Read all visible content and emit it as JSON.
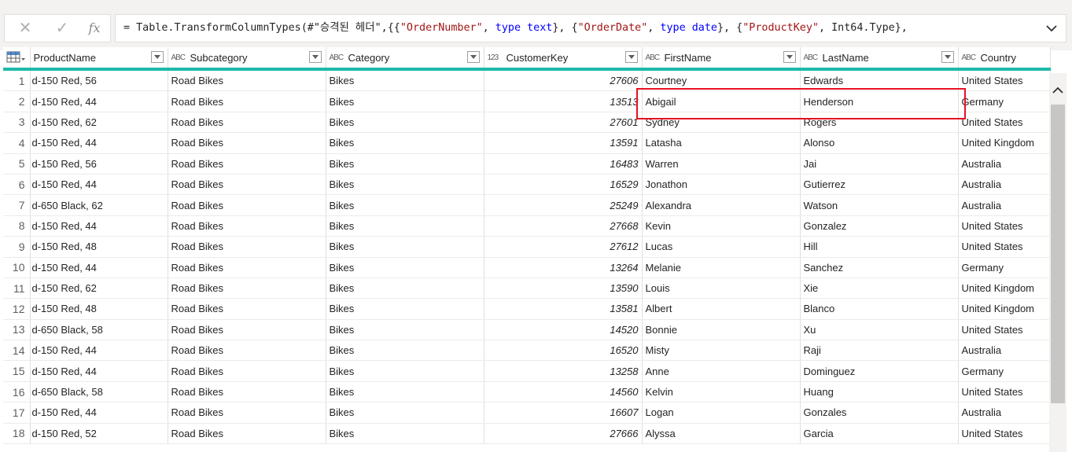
{
  "formula_bar": {
    "cancel_glyph": "✕",
    "commit_glyph": "✓",
    "fx_glyph": "fx",
    "formula_parts": [
      {
        "t": "= Table.TransformColumnTypes(#\"승격된 헤더\",{{",
        "c": "plain"
      },
      {
        "t": "\"OrderNumber\"",
        "c": "str"
      },
      {
        "t": ", ",
        "c": "plain"
      },
      {
        "t": "type",
        "c": "kw"
      },
      {
        "t": " ",
        "c": "plain"
      },
      {
        "t": "text",
        "c": "kw"
      },
      {
        "t": "}, {",
        "c": "plain"
      },
      {
        "t": "\"OrderDate\"",
        "c": "str"
      },
      {
        "t": ", ",
        "c": "plain"
      },
      {
        "t": "type",
        "c": "kw"
      },
      {
        "t": " ",
        "c": "plain"
      },
      {
        "t": "date",
        "c": "kw"
      },
      {
        "t": "}, {",
        "c": "plain"
      },
      {
        "t": "\"ProductKey\"",
        "c": "str"
      },
      {
        "t": ", Int64.Type},",
        "c": "plain"
      }
    ]
  },
  "columns": [
    {
      "name": "ProductName",
      "type_icon": "",
      "dropdown": true
    },
    {
      "name": "Subcategory",
      "type_icon": "ABC",
      "dropdown": true
    },
    {
      "name": "Category",
      "type_icon": "ABC",
      "dropdown": true
    },
    {
      "name": "CustomerKey",
      "type_icon": "123",
      "dropdown": true
    },
    {
      "name": "FirstName",
      "type_icon": "ABC",
      "dropdown": true
    },
    {
      "name": "LastName",
      "type_icon": "ABC",
      "dropdown": true
    },
    {
      "name": "Country",
      "type_icon": "ABC",
      "dropdown": false
    }
  ],
  "rows": [
    [
      "1",
      "d-150 Red, 56",
      "Road Bikes",
      "Bikes",
      "27606",
      "Courtney",
      "Edwards",
      "United States"
    ],
    [
      "2",
      "d-150 Red, 44",
      "Road Bikes",
      "Bikes",
      "13513",
      "Abigail",
      "Henderson",
      "Germany"
    ],
    [
      "3",
      "d-150 Red, 62",
      "Road Bikes",
      "Bikes",
      "27601",
      "Sydney",
      "Rogers",
      "United States"
    ],
    [
      "4",
      "d-150 Red, 44",
      "Road Bikes",
      "Bikes",
      "13591",
      "Latasha",
      "Alonso",
      "United Kingdom"
    ],
    [
      "5",
      "d-150 Red, 56",
      "Road Bikes",
      "Bikes",
      "16483",
      "Warren",
      "Jai",
      "Australia"
    ],
    [
      "6",
      "d-150 Red, 44",
      "Road Bikes",
      "Bikes",
      "16529",
      "Jonathon",
      "Gutierrez",
      "Australia"
    ],
    [
      "7",
      "d-650 Black, 62",
      "Road Bikes",
      "Bikes",
      "25249",
      "Alexandra",
      "Watson",
      "Australia"
    ],
    [
      "8",
      "d-150 Red, 44",
      "Road Bikes",
      "Bikes",
      "27668",
      "Kevin",
      "Gonzalez",
      "United States"
    ],
    [
      "9",
      "d-150 Red, 48",
      "Road Bikes",
      "Bikes",
      "27612",
      "Lucas",
      "Hill",
      "United States"
    ],
    [
      "10",
      "d-150 Red, 44",
      "Road Bikes",
      "Bikes",
      "13264",
      "Melanie",
      "Sanchez",
      "Germany"
    ],
    [
      "11",
      "d-150 Red, 62",
      "Road Bikes",
      "Bikes",
      "13590",
      "Louis",
      "Xie",
      "United Kingdom"
    ],
    [
      "12",
      "d-150 Red, 48",
      "Road Bikes",
      "Bikes",
      "13581",
      "Albert",
      "Blanco",
      "United Kingdom"
    ],
    [
      "13",
      "d-650 Black, 58",
      "Road Bikes",
      "Bikes",
      "14520",
      "Bonnie",
      "Xu",
      "United States"
    ],
    [
      "14",
      "d-150 Red, 44",
      "Road Bikes",
      "Bikes",
      "16520",
      "Misty",
      "Raji",
      "Australia"
    ],
    [
      "15",
      "d-150 Red, 44",
      "Road Bikes",
      "Bikes",
      "13258",
      "Anne",
      "Dominguez",
      "Germany"
    ],
    [
      "16",
      "d-650 Black, 58",
      "Road Bikes",
      "Bikes",
      "14560",
      "Kelvin",
      "Huang",
      "United States"
    ],
    [
      "17",
      "d-150 Red, 44",
      "Road Bikes",
      "Bikes",
      "16607",
      "Logan",
      "Gonzales",
      "Australia"
    ],
    [
      "18",
      "d-150 Red, 52",
      "Road Bikes",
      "Bikes",
      "27666",
      "Alyssa",
      "Garcia",
      "United States"
    ]
  ],
  "colors": {
    "accent": "#1fb8aa",
    "highlight": "#e81123",
    "string": "#a31515",
    "keyword": "#0000ff"
  }
}
